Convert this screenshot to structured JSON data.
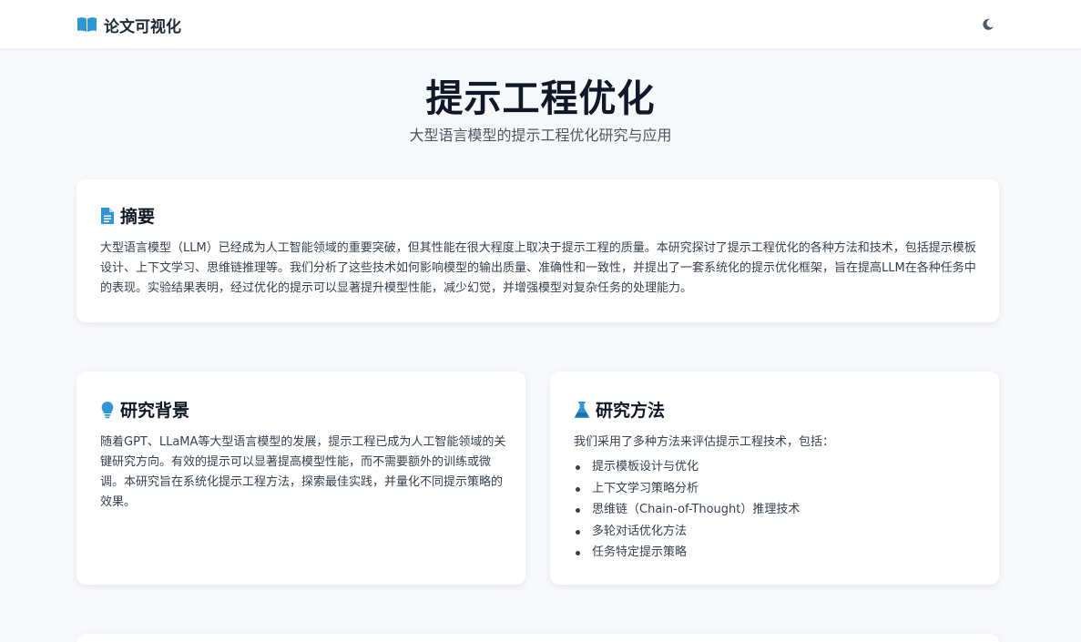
{
  "navbar": {
    "brand_icon": "book-open-icon",
    "brand": "论文可视化",
    "theme_icon": "moon-icon"
  },
  "hero": {
    "title": "提示工程优化",
    "subtitle": "大型语言模型的提示工程优化研究与应用"
  },
  "abstract": {
    "icon": "document-icon",
    "title": "摘要",
    "text": "大型语言模型（LLM）已经成为人工智能领域的重要突破，但其性能在很大程度上取决于提示工程的质量。本研究探讨了提示工程优化的各种方法和技术，包括提示模板设计、上下文学习、思维链推理等。我们分析了这些技术如何影响模型的输出质量、准确性和一致性，并提出了一套系统化的提示优化框架，旨在提高LLM在各种任务中的表现。实验结果表明，经过优化的提示可以显著提升模型性能，减少幻觉，并增强模型对复杂任务的处理能力。"
  },
  "background": {
    "icon": "lightbulb-icon",
    "title": "研究背景",
    "text": "随着GPT、LLaMA等大型语言模型的发展，提示工程已成为人工智能领域的关键研究方向。有效的提示可以显著提高模型性能，而不需要额外的训练或微调。本研究旨在系统化提示工程方法，探索最佳实践，并量化不同提示策略的效果。"
  },
  "method": {
    "icon": "flask-icon",
    "title": "研究方法",
    "intro": "我们采用了多种方法来评估提示工程技术，包括：",
    "items": [
      "提示模板设计与优化",
      "上下文学习策略分析",
      "思维链（Chain-of-Thought）推理技术",
      "多轮对话优化方法",
      "任务特定提示策略"
    ]
  },
  "colors": {
    "accent": "#2f95d3",
    "background": "#f7f8fa",
    "card": "#ffffff",
    "text": "#1f2937"
  }
}
